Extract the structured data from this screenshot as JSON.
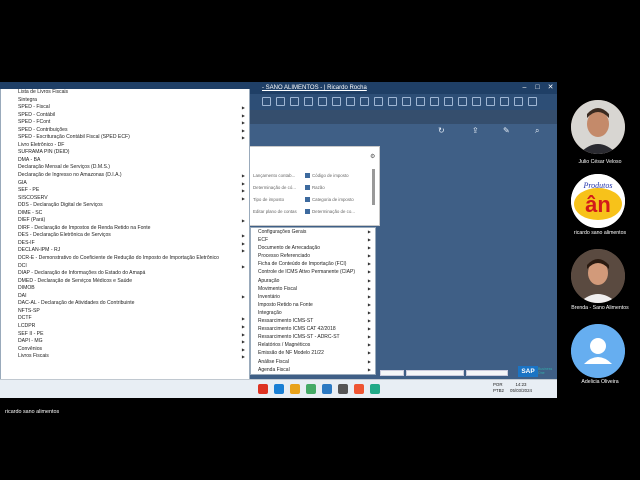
{
  "window": {
    "title": "- SANO ALIMENTOS - | Ricardo Rocha",
    "controls": [
      "minimize-icon",
      "maximize-icon",
      "close-icon"
    ]
  },
  "left_menu": {
    "items": [
      {
        "label": "Lista de Livros Fiscais",
        "submenu": false
      },
      {
        "label": "Sintegra",
        "submenu": false
      },
      {
        "label": "SPED - Fiscal",
        "submenu": true
      },
      {
        "label": "SPED - Contábil",
        "submenu": true
      },
      {
        "label": "SPED - FCont",
        "submenu": true
      },
      {
        "label": "SPED - Contribuições",
        "submenu": true
      },
      {
        "label": "SPED - Escrituração Contábil Fiscal (SPED ECF)",
        "submenu": true
      },
      {
        "label": "Livro Eletrônico - DF",
        "submenu": false
      },
      {
        "label": "SUFRAMA PIN (DEID)",
        "submenu": false
      },
      {
        "label": "DMA - BA",
        "submenu": false
      },
      {
        "label": "Declaração Mensal de Serviços (D.M.S.)",
        "submenu": false
      },
      {
        "label": "Declaração de Ingresso no Amazonas (D.I.A.)",
        "submenu": true
      },
      {
        "label": "GIA",
        "submenu": true
      },
      {
        "label": "SEF - PE",
        "submenu": true
      },
      {
        "label": "SISCOSERV",
        "submenu": true
      },
      {
        "label": "DDS - Declaração Digital de Serviços",
        "submenu": false
      },
      {
        "label": "DIME - SC",
        "submenu": false
      },
      {
        "label": "DIEF (Pará)",
        "submenu": true
      },
      {
        "label": "DIRF - Declaração de Impostos de Renda Retido na Fonte",
        "submenu": false
      },
      {
        "label": "DES - Declaração Eletrônica de Serviços",
        "submenu": true
      },
      {
        "label": "DES-IF",
        "submenu": true
      },
      {
        "label": "DECLAN-IPM - RJ",
        "submenu": true
      },
      {
        "label": "DCR-E - Demonstrativo do Coeficiente de Redução do Imposto de Importação Eletrônico",
        "submenu": false
      },
      {
        "label": "DCI",
        "submenu": true
      },
      {
        "label": "DIAP - Declaração de Informações do Estado do Amapá",
        "submenu": false
      },
      {
        "label": "DMED - Declaração de Serviços Médicos e Saúde",
        "submenu": false
      },
      {
        "label": "DIMOB",
        "submenu": false
      },
      {
        "label": "DAI",
        "submenu": true
      },
      {
        "label": "DAC-AL - Declaração de Atividades do Contribuinte",
        "submenu": false
      },
      {
        "label": "NFTS-SP",
        "submenu": false
      },
      {
        "label": "DCTF",
        "submenu": true
      },
      {
        "label": "LCDPR",
        "submenu": true
      },
      {
        "label": "SEF II - PE",
        "submenu": true
      },
      {
        "label": "DAPI - MG",
        "submenu": true
      },
      {
        "label": "Convênios",
        "submenu": true
      },
      {
        "label": "Livros Fiscais",
        "submenu": true
      }
    ]
  },
  "right_menu": {
    "items": [
      {
        "label": "Configurações Gerais",
        "submenu": true
      },
      {
        "label": "ECF",
        "submenu": true
      },
      {
        "label": "Documento de Arrecadação",
        "submenu": true
      },
      {
        "label": "Processo Referenciado",
        "submenu": true
      },
      {
        "label": "Ficha de Conteúdo de Importação (FCI)",
        "submenu": true
      },
      {
        "label": "Controle de ICMS Ativo Permanente (CIAP)",
        "submenu": true
      },
      {
        "label": "Apuração",
        "submenu": true
      },
      {
        "label": "Movimento Fiscal",
        "submenu": true
      },
      {
        "label": "Inventário",
        "submenu": true
      },
      {
        "label": "Imposto Retido na Fonte",
        "submenu": true
      },
      {
        "label": "Integração",
        "submenu": true
      },
      {
        "label": "Ressarcimento ICMS-ST",
        "submenu": true
      },
      {
        "label": "Ressarcimento ICMS CAT 42/2018",
        "submenu": true
      },
      {
        "label": "Ressarcimento ICMS-ST - ADRC-ST",
        "submenu": true
      },
      {
        "label": "Relatórios / Magnéticos",
        "submenu": true
      },
      {
        "label": "Emissão de NF Modelo 21/22",
        "submenu": true
      },
      {
        "label": "Análise Fiscal",
        "submenu": true
      },
      {
        "label": "Agenda Fiscal",
        "submenu": true
      }
    ]
  },
  "dialog": {
    "left_items": [
      "Lançamento contab...",
      "Determinação de có...",
      "Tipo de imposto",
      "Editar plano de contas"
    ],
    "right_items": [
      "Código de imposto",
      "Razão",
      "Categoria de imposto",
      "Determinação de co..."
    ]
  },
  "taskbar": {
    "lang": "POR\nPTB2",
    "time": "14:23",
    "date": "05/03/2024",
    "brand": "SAP",
    "brand_sub": "Business One"
  },
  "participants": [
    {
      "name": "Julio César Veloso"
    },
    {
      "name": "ricardo sano alimentos",
      "logo_text": "Produtos ân"
    },
    {
      "name": "Brenda - Sano Alimentos"
    },
    {
      "name": "Adelicia Oliveira"
    }
  ],
  "footer": {
    "speaker_name": "ricardo sano alimentos"
  },
  "colors": {
    "sap_blue": "#1b74c4",
    "menu_bg": "#ffffff",
    "screen_bg": "#3c5b80"
  }
}
